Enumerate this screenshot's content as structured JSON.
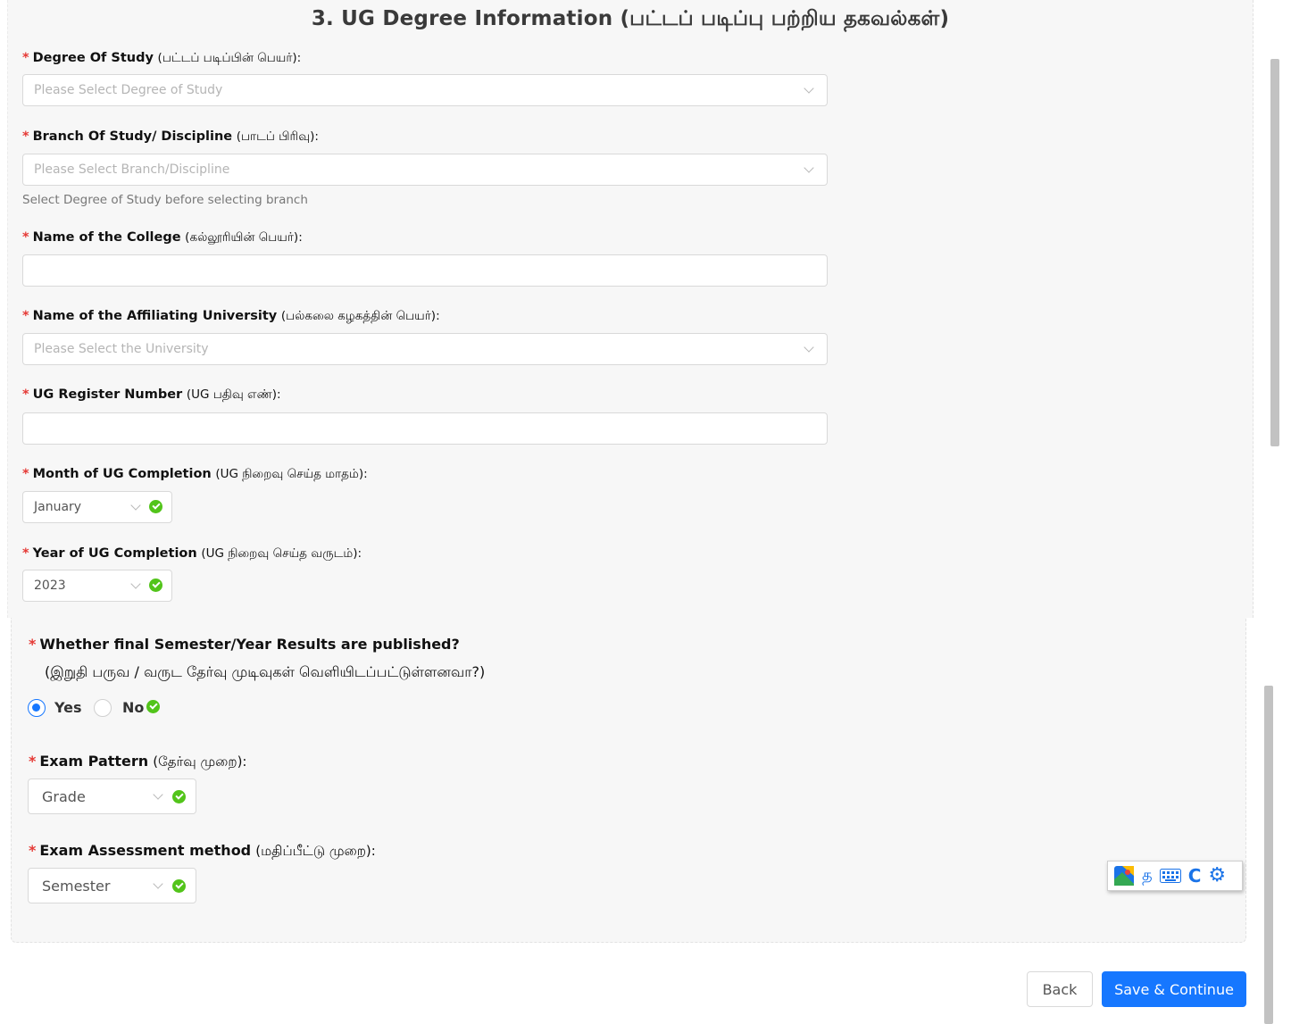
{
  "section": {
    "title": "3. UG Degree Information (பட்டப் படிப்பு பற்றிய தகவல்கள்)"
  },
  "fields": {
    "degree": {
      "label": "Degree Of Study",
      "label_ta": "(பட்டப் படிப்பின் பெயர்):",
      "placeholder": "Please Select Degree of Study"
    },
    "branch": {
      "label": "Branch Of Study/ Discipline",
      "label_ta": "(பாடப் பிரிவு):",
      "placeholder": "Please Select Branch/Discipline",
      "help": "Select Degree of Study before selecting branch"
    },
    "college": {
      "label": "Name of the College",
      "label_ta": "(கல்லூரியின் பெயர்):",
      "value": ""
    },
    "university": {
      "label": "Name of the Affiliating University",
      "label_ta": "(பல்கலை கழகத்தின் பெயர்):",
      "placeholder": "Please Select the University"
    },
    "register": {
      "label": "UG Register Number",
      "label_ta": "(UG பதிவு எண்):",
      "value": ""
    },
    "month": {
      "label": "Month of UG Completion",
      "label_ta": "(UG நிறைவு செய்த மாதம்):",
      "value": "January"
    },
    "year": {
      "label": "Year of UG Completion",
      "label_ta": "(UG நிறைவு செய்த வருடம்):",
      "value": "2023"
    },
    "results": {
      "label": "Whether final Semester/Year Results are published?",
      "label_ta": "(இறுதி பருவ / வருட தேர்வு முடிவுகள் வெளியிடப்பட்டுள்ளனவா?)",
      "options": [
        "Yes",
        "No"
      ],
      "selected": "Yes"
    },
    "pattern": {
      "label": "Exam Pattern",
      "label_ta": "(தேர்வு முறை):",
      "value": "Grade"
    },
    "assessment": {
      "label": "Exam Assessment method",
      "label_ta": "(மதிப்பீட்டு முறை):",
      "value": "Semester"
    }
  },
  "buttons": {
    "back": "Back",
    "save": "Save & Continue"
  },
  "ime_toolbar": {
    "icons": [
      "map-logo-icon",
      "tamil-script-icon",
      "keyboard-icon",
      "refresh-c-icon",
      "gear-icon"
    ],
    "tamil_glyph": "த",
    "c_glyph": "C"
  },
  "colors": {
    "primary": "#1677ff",
    "success": "#52c41a",
    "required": "#e53935"
  }
}
